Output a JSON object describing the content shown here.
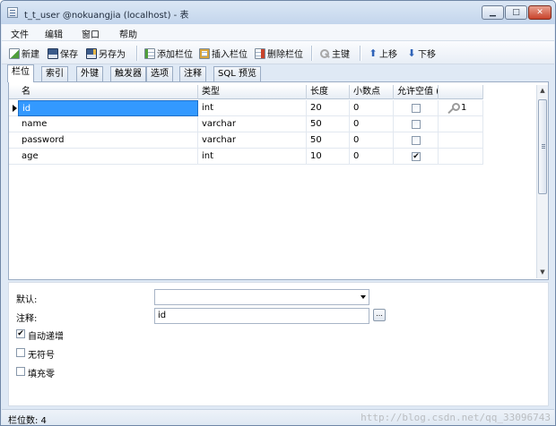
{
  "window": {
    "title": "t_t_user @nokuangjia (localhost) - 表"
  },
  "menu": [
    "文件",
    "编辑",
    "窗口",
    "帮助"
  ],
  "toolbar": {
    "new": "新建",
    "save": "保存",
    "save_as": "另存为",
    "add_column": "添加栏位",
    "insert_column": "插入栏位",
    "delete_column": "删除栏位",
    "primary_key": "主键",
    "move_up": "上移",
    "move_down": "下移"
  },
  "tabs": [
    "栏位",
    "索引",
    "外键",
    "触发器",
    "选项",
    "注释",
    "SQL 预览"
  ],
  "grid": {
    "headers": [
      "名",
      "类型",
      "长度",
      "小数点",
      "允许空值 ("
    ],
    "rows": [
      {
        "name": "id",
        "type": "int",
        "length": "20",
        "decimals": "0",
        "nullable": false,
        "key": "1"
      },
      {
        "name": "name",
        "type": "varchar",
        "length": "50",
        "decimals": "0",
        "nullable": false,
        "key": ""
      },
      {
        "name": "password",
        "type": "varchar",
        "length": "50",
        "decimals": "0",
        "nullable": false,
        "key": ""
      },
      {
        "name": "age",
        "type": "int",
        "length": "10",
        "decimals": "0",
        "nullable": true,
        "key": ""
      }
    ]
  },
  "properties": {
    "default_label": "默认:",
    "default_value": "",
    "comment_label": "注释:",
    "comment_value": "id",
    "dots": "...",
    "auto_increment_label": "自动递增",
    "auto_increment": true,
    "unsigned_label": "无符号",
    "unsigned": false,
    "zerofill_label": "填充零",
    "zerofill": false
  },
  "status": {
    "text": "栏位数: 4"
  },
  "watermark": "http://blog.csdn.net/qq_33096743"
}
